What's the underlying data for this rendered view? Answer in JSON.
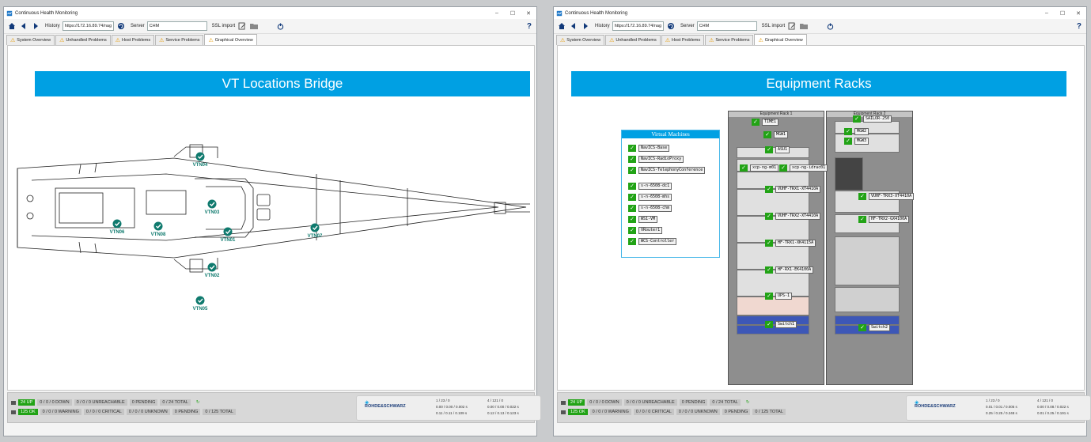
{
  "windows": [
    {
      "title": "Continuous Health Monitoring",
      "history_label": "History",
      "history_value": "https://172.16.89.74/nag",
      "server_label": "Server",
      "server_value": "CHM",
      "ssl_label": "SSL import",
      "help": "?",
      "tabs": [
        "System Overview",
        "Unhandled Problems",
        "Host Problems",
        "Service Problems",
        "Graphical Overview"
      ],
      "banner": "VT Locations Bridge",
      "markers": [
        "VTN04",
        "VTN03",
        "VTN06",
        "VTN08",
        "VTN01",
        "VTN07",
        "VTN02",
        "VTN05"
      ],
      "status": {
        "up": "24 UP",
        "down": "0 / 0 / 0 DOWN",
        "unreachable": "0 / 0 / 0 UNREACHABLE",
        "pending": "0 PENDING",
        "total": "0 / 24 TOTAL",
        "ok": "125 OK",
        "warning": "0 / 0 / 0 WARNING",
        "critical": "0 / 0 / 0 CRITICAL",
        "unknown": "0 / 0 / 0 UNKNOWN",
        "pending2": "0 PENDING",
        "total2": "0 / 125 TOTAL",
        "logo": "ROHDE&SCHWARZ",
        "m1": "1 / 23 / 0",
        "m2": "0.00 / 0.00 / 0.002 s",
        "m3": "0.11 / 0.11 / 0.109 s",
        "m4": "4 / 121 / 0",
        "m5": "0.00 / 0.00 / 0.022 s",
        "m6": "0.12 / 0.13 / 0.123 s"
      }
    },
    {
      "title": "Continuous Health Monitoring",
      "history_label": "History",
      "history_value": "https://172.16.89.74/nag",
      "server_label": "Server",
      "server_value": "CHM",
      "ssl_label": "SSL import",
      "help": "?",
      "tabs": [
        "System Overview",
        "Unhandled Problems",
        "Host Problems",
        "Service Problems",
        "Graphical Overview"
      ],
      "banner": "Equipment Racks",
      "vm_title": "Virtual Machines",
      "vms": [
        "NavICS-Base",
        "NavICS-RadioProxy",
        "NavICS-TelephonyConference",
        "s-n-6508-dc1",
        "s-n-6508-mhs",
        "s-n-6508-chm",
        "WS1-VM",
        "VRouter1",
        "WCS-Controller"
      ],
      "rack1_title": "Equipment Rack 1",
      "rack2_title": "Equipment Rack 2",
      "rack1_items": [
        "TIME1",
        "MGW1",
        "ASU1",
        "xcp-ng-m01",
        "xcp-ng-idrac01",
        "VUHF-TRX1-XT4410A",
        "VUHF-TRX2-XT4410A",
        "HF-TRX1-XK4115A",
        "HF-RX1-EK4100A",
        "UPS-1",
        "Switch1"
      ],
      "rack2_items": [
        "SAILOR-250",
        "MGW2",
        "MGW3",
        "VUHF-TRX3-XT4410A",
        "HF-TRX2-GX4100A",
        "Switch2"
      ],
      "status": {
        "up": "24 UP",
        "down": "0 / 0 / 0 DOWN",
        "unreachable": "0 / 0 / 0 UNREACHABLE",
        "pending": "0 PENDING",
        "total": "0 / 24 TOTAL",
        "ok": "125 OK",
        "warning": "0 / 0 / 0 WARNING",
        "critical": "0 / 0 / 0 CRITICAL",
        "unknown": "0 / 0 / 0 UNKNOWN",
        "pending2": "0 PENDING",
        "total2": "0 / 125 TOTAL",
        "logo": "ROHDE&SCHWARZ",
        "m1": "1 / 23 / 0",
        "m2": "0.01 / 0.01 / 0.005 s",
        "m3": "0.25 / 0.25 / 0.248 s",
        "m4": "4 / 121 / 0",
        "m5": "0.00 / 0.08 / 0.022 s",
        "m6": "0.01 / 0.25 / 0.191 s"
      }
    }
  ],
  "colors": {
    "accent": "#00a0e3",
    "ok": "#22a316",
    "teal": "#0f7a6e",
    "warn": "#e79a00"
  }
}
